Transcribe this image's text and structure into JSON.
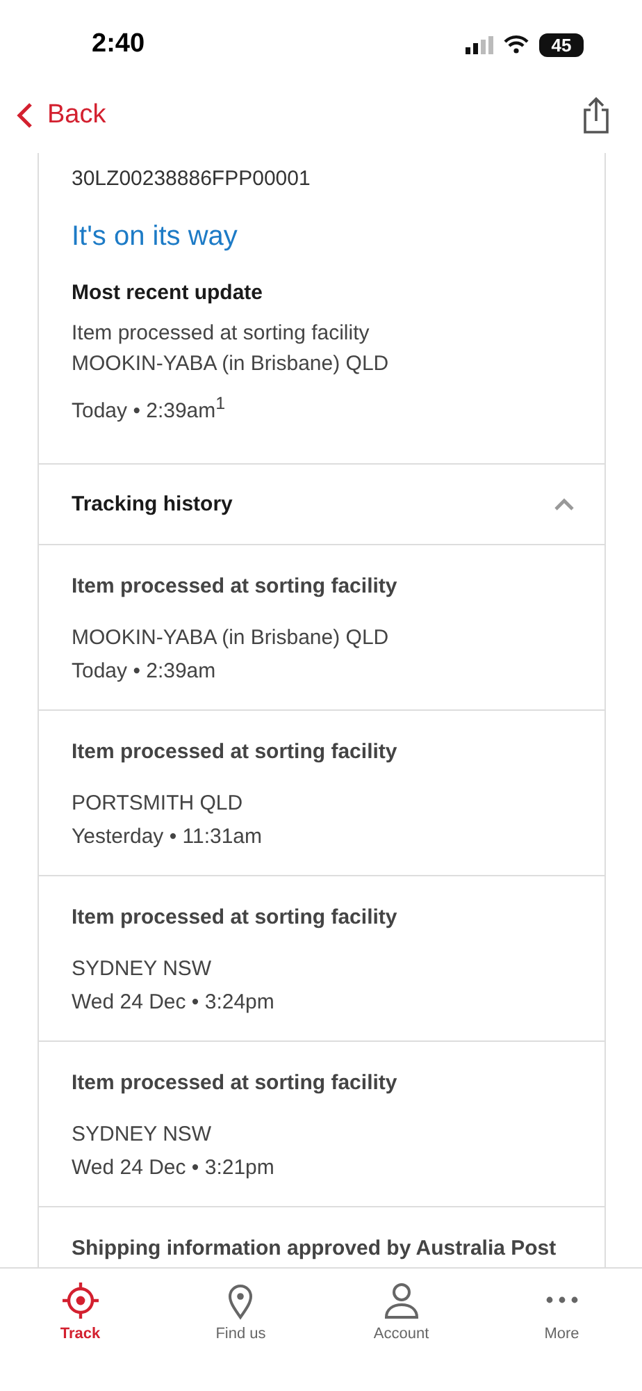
{
  "status_bar": {
    "time": "2:40",
    "battery": "45"
  },
  "nav": {
    "back": "Back"
  },
  "summary": {
    "tracking_number": "30LZ00238886FPP00001",
    "status": "It's on its way",
    "recent_heading": "Most recent update",
    "recent_lines": [
      "Item processed at sorting facility",
      "MOOKIN-YABA (in Brisbane) QLD"
    ],
    "recent_time": "Today • 2:39am$^{1}$"
  },
  "history": {
    "title": "Tracking history",
    "expanded": true,
    "events": [
      {
        "title": "Item processed at sorting facility",
        "location": "MOOKIN-YABA (in Brisbane) QLD",
        "time": "Today • 2:39am"
      },
      {
        "title": "Item processed at sorting facility",
        "location": "PORTSMITH QLD",
        "time": "Yesterday • 11:31am"
      },
      {
        "title": "Item processed at sorting facility",
        "location": "SYDNEY NSW",
        "time": "Wed 24 Dec • 3:24pm"
      },
      {
        "title": "Item processed at sorting facility",
        "location": "SYDNEY NSW",
        "time": "Wed 24 Dec • 3:21pm"
      },
      {
        "title": "Shipping information approved by Australia Post"
      }
    ]
  },
  "tabs": [
    {
      "kind": "track",
      "label": "Track",
      "selected": true
    },
    {
      "kind": "pin",
      "label": "Find us",
      "selected": false
    },
    {
      "kind": "person",
      "label": "Account",
      "selected": false
    },
    {
      "kind": "more",
      "label": "More",
      "selected": false
    }
  ]
}
